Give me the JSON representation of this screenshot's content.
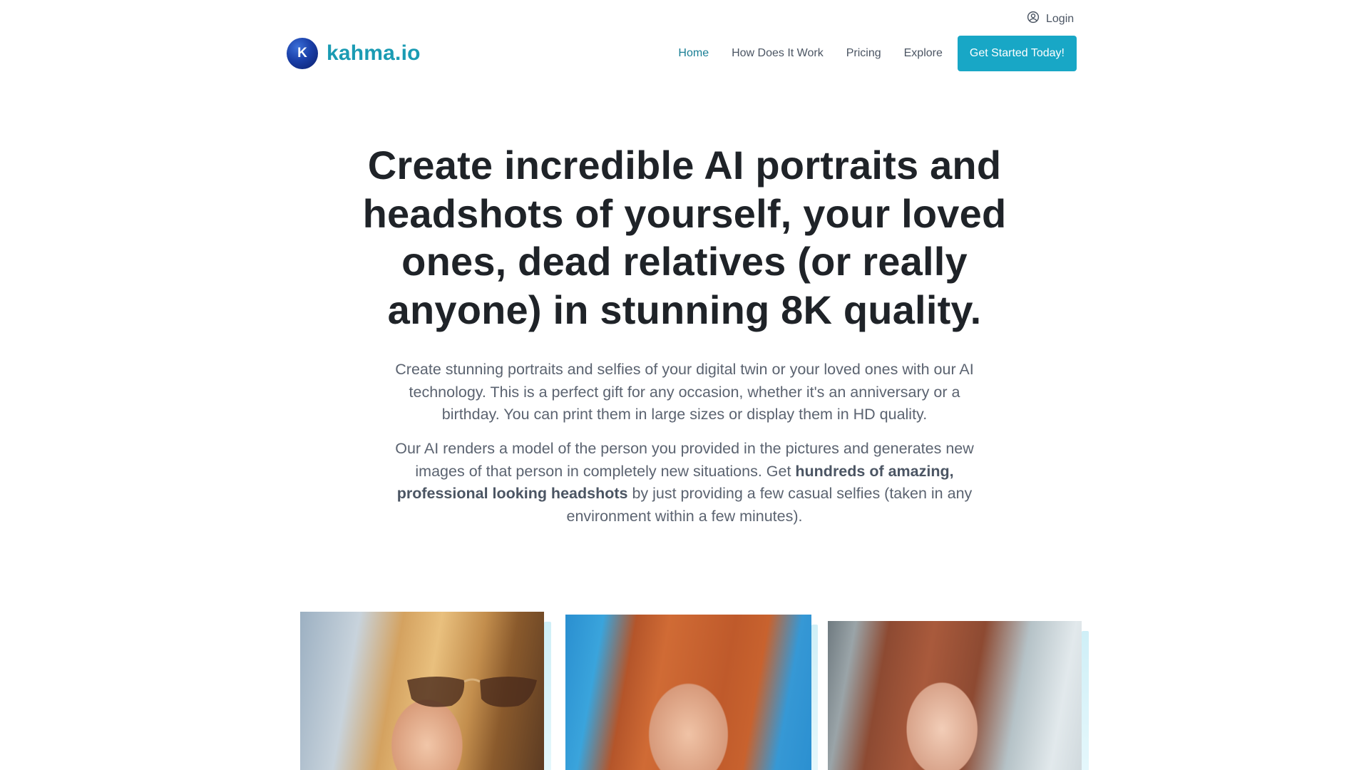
{
  "header": {
    "login_label": "Login",
    "brand_initial": "K",
    "brand_name": "kahma.io",
    "nav": [
      {
        "label": "Home",
        "active": true
      },
      {
        "label": "How Does It Work",
        "active": false
      },
      {
        "label": "Pricing",
        "active": false
      },
      {
        "label": "Explore",
        "active": false
      }
    ],
    "cta_label": "Get Started Today!"
  },
  "hero": {
    "title": "Create incredible AI portraits and headshots of yourself, your loved ones, dead relatives (or really anyone) in stunning 8K quality.",
    "paragraph1": "Create stunning portraits and selfies of your digital twin or your loved ones with our AI technology. This is a perfect gift for any occasion, whether it's an anniversary or a birthday. You can print them in large sizes or display them in HD quality.",
    "paragraph2_before": "Our AI renders a model of the person you provided in the pictures and generates new images of that person in completely new situations. Get ",
    "paragraph2_bold": "hundreds of amazing, professional looking headshots",
    "paragraph2_after": " by just providing a few casual selfies (taken in any environment within a few minutes)."
  },
  "gallery": {
    "items": [
      {
        "subject": "woman-sunglasses-blonde-portrait"
      },
      {
        "subject": "woman-red-hair-beach-portrait"
      },
      {
        "subject": "woman-auburn-hair-office-portrait"
      }
    ]
  },
  "colors": {
    "brand": "#1a9bb3",
    "cta": "#18a7c6",
    "nav_active": "#1a7f95",
    "text": "#1f2328",
    "muted": "#5b6370"
  },
  "icons": {
    "login": "user-circle-icon",
    "logo": "k-logo-icon"
  }
}
